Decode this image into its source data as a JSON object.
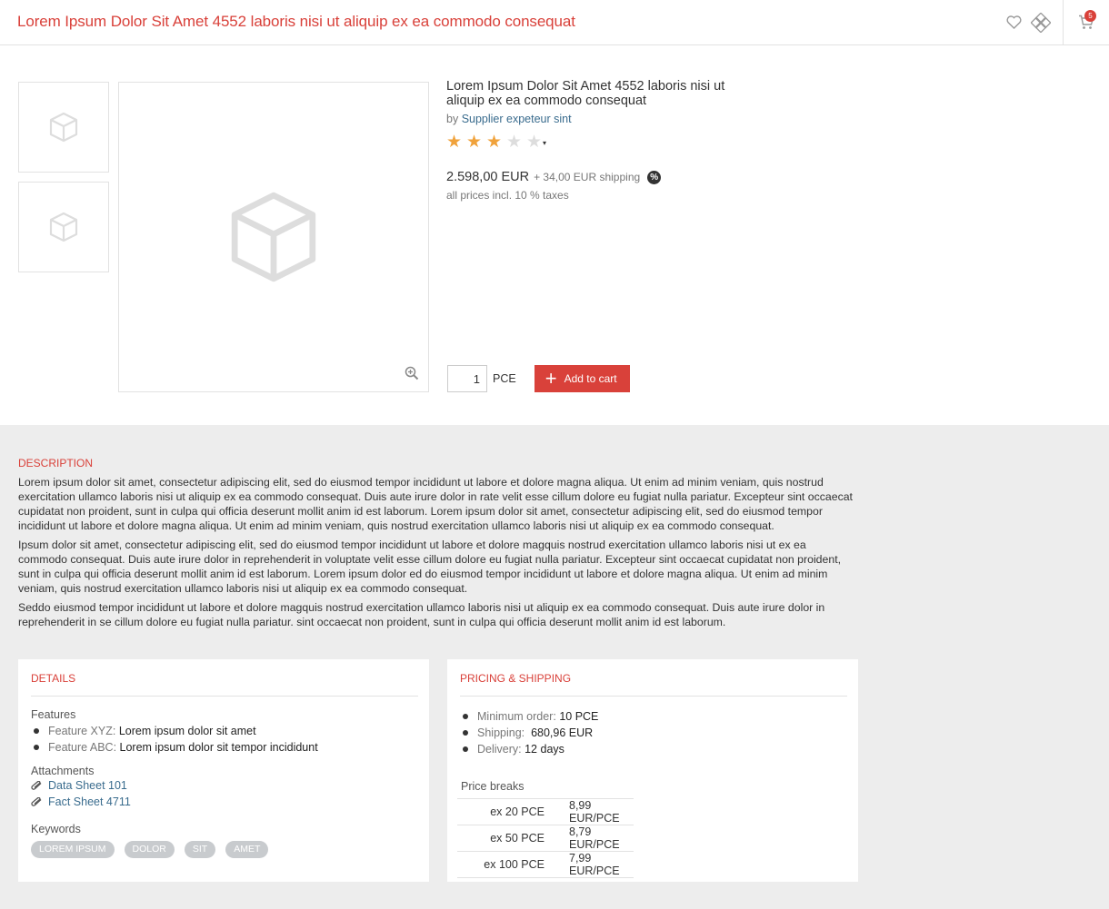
{
  "header": {
    "title": "Lorem Ipsum Dolor Sit Amet 4552 laboris nisi ut aliquip ex ea commodo consequat",
    "cart_count": "5"
  },
  "product": {
    "title": "Lorem Ipsum Dolor Sit Amet 4552 laboris nisi ut aliquip ex ea commodo consequat",
    "by_label": "by",
    "supplier": "Supplier expeteur sint",
    "rating": 3,
    "rating_max": 5,
    "price": "2.598,00 EUR",
    "shipping": "+ 34,00 EUR shipping",
    "tax_badge": "%",
    "taxes_note": "all prices incl. 10 % taxes",
    "quantity": "1",
    "unit": "PCE",
    "add_to_cart": "Add to cart"
  },
  "description": {
    "heading": "DESCRIPTION",
    "paragraphs": [
      "Lorem ipsum dolor sit amet, consectetur adipiscing elit, sed do eiusmod tempor incididunt ut labore et dolore magna aliqua. Ut enim ad minim veniam, quis nostrud exercitation ullamco laboris nisi ut aliquip ex ea commodo consequat. Duis aute irure dolor in rate velit esse cillum dolore eu fugiat nulla pariatur. Excepteur sint occaecat cupidatat non proident, sunt in culpa qui officia deserunt mollit anim id est laborum. Lorem ipsum dolor sit amet, consectetur adipiscing elit, sed do eiusmod tempor incididunt ut labore et dolore magna aliqua. Ut enim ad minim veniam, quis nostrud exercitation ullamco laboris nisi ut aliquip ex ea commodo consequat.",
      "Ipsum dolor sit amet, consectetur adipiscing elit, sed do eiusmod tempor incididunt ut labore et dolore magquis nostrud exercitation ullamco laboris nisi ut ex ea commodo consequat. Duis aute irure dolor in reprehenderit in voluptate velit esse cillum dolore eu fugiat nulla pariatur. Excepteur sint occaecat cupidatat non proident, sunt in culpa qui officia deserunt mollit anim id est laborum. Lorem ipsum dolor ed do eiusmod tempor incididunt ut labore et dolore magna aliqua. Ut enim ad minim veniam, quis nostrud exercitation ullamco laboris nisi ut aliquip ex ea commodo consequat.",
      "Seddo eiusmod tempor incididunt ut labore et dolore magquis nostrud exercitation ullamco laboris nisi ut aliquip ex ea commodo consequat. Duis aute irure dolor in reprehenderit in se cillum dolore eu fugiat nulla pariatur. sint occaecat non proident, sunt in culpa qui officia deserunt mollit anim id est laborum."
    ]
  },
  "details": {
    "heading": "DETAILS",
    "features_label": "Features",
    "features": [
      {
        "key": "Feature XYZ:",
        "value": "Lorem ipsum dolor sit amet"
      },
      {
        "key": "Feature ABC:",
        "value": "Lorem ipsum dolor sit tempor incididunt"
      }
    ],
    "attachments_label": "Attachments",
    "attachments": [
      "Data Sheet 101",
      "Fact Sheet 4711"
    ],
    "keywords_label": "Keywords",
    "keywords": [
      "LOREM IPSUM",
      "DOLOR",
      "SIT",
      "AMET"
    ]
  },
  "pricing": {
    "heading": "PRICING & SHIPPING",
    "items": [
      {
        "key": "Minimum order:",
        "value": "10 PCE"
      },
      {
        "key": "Shipping:",
        "value": "680,96 EUR"
      },
      {
        "key": "Delivery:",
        "value": "12 days"
      }
    ],
    "breaks_label": "Price breaks",
    "breaks": [
      {
        "qty": "ex 20 PCE",
        "price": "8,99 EUR/PCE"
      },
      {
        "qty": "ex 50 PCE",
        "price": "8,79 EUR/PCE"
      },
      {
        "qty": "ex 100 PCE",
        "price": "7,99 EUR/PCE"
      }
    ]
  },
  "colors": {
    "accent": "#d9413a",
    "link": "#3a6c8e",
    "star": "#f0a23b",
    "background": "#ededed"
  },
  "icons": [
    "heart-icon",
    "compare-icon",
    "cart-icon",
    "box-placeholder-icon",
    "zoom-in-icon",
    "paperclip-icon"
  ]
}
